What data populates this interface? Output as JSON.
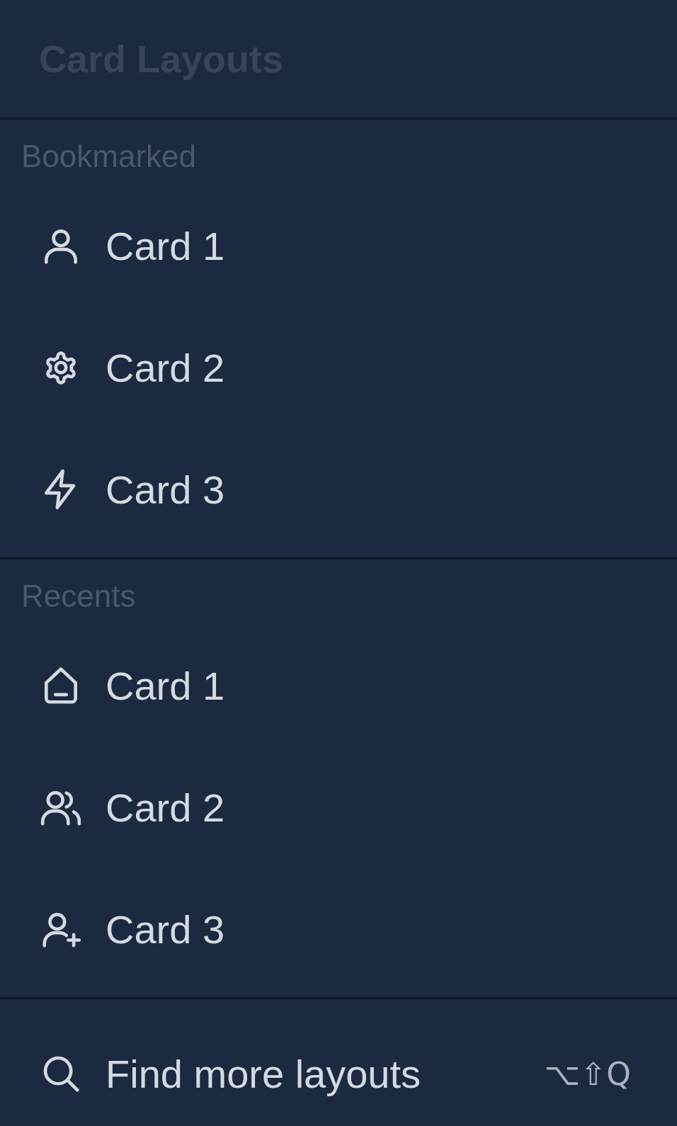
{
  "title": "Card Layouts",
  "sections": [
    {
      "label": "Bookmarked",
      "items": [
        {
          "label": "Card 1"
        },
        {
          "label": "Card 2"
        },
        {
          "label": "Card 3"
        }
      ]
    },
    {
      "label": "Recents",
      "items": [
        {
          "label": "Card 1"
        },
        {
          "label": "Card 2"
        },
        {
          "label": "Card 3"
        }
      ]
    }
  ],
  "footer": {
    "label": "Find more layouts",
    "shortcut": "⌥⇧Q"
  }
}
